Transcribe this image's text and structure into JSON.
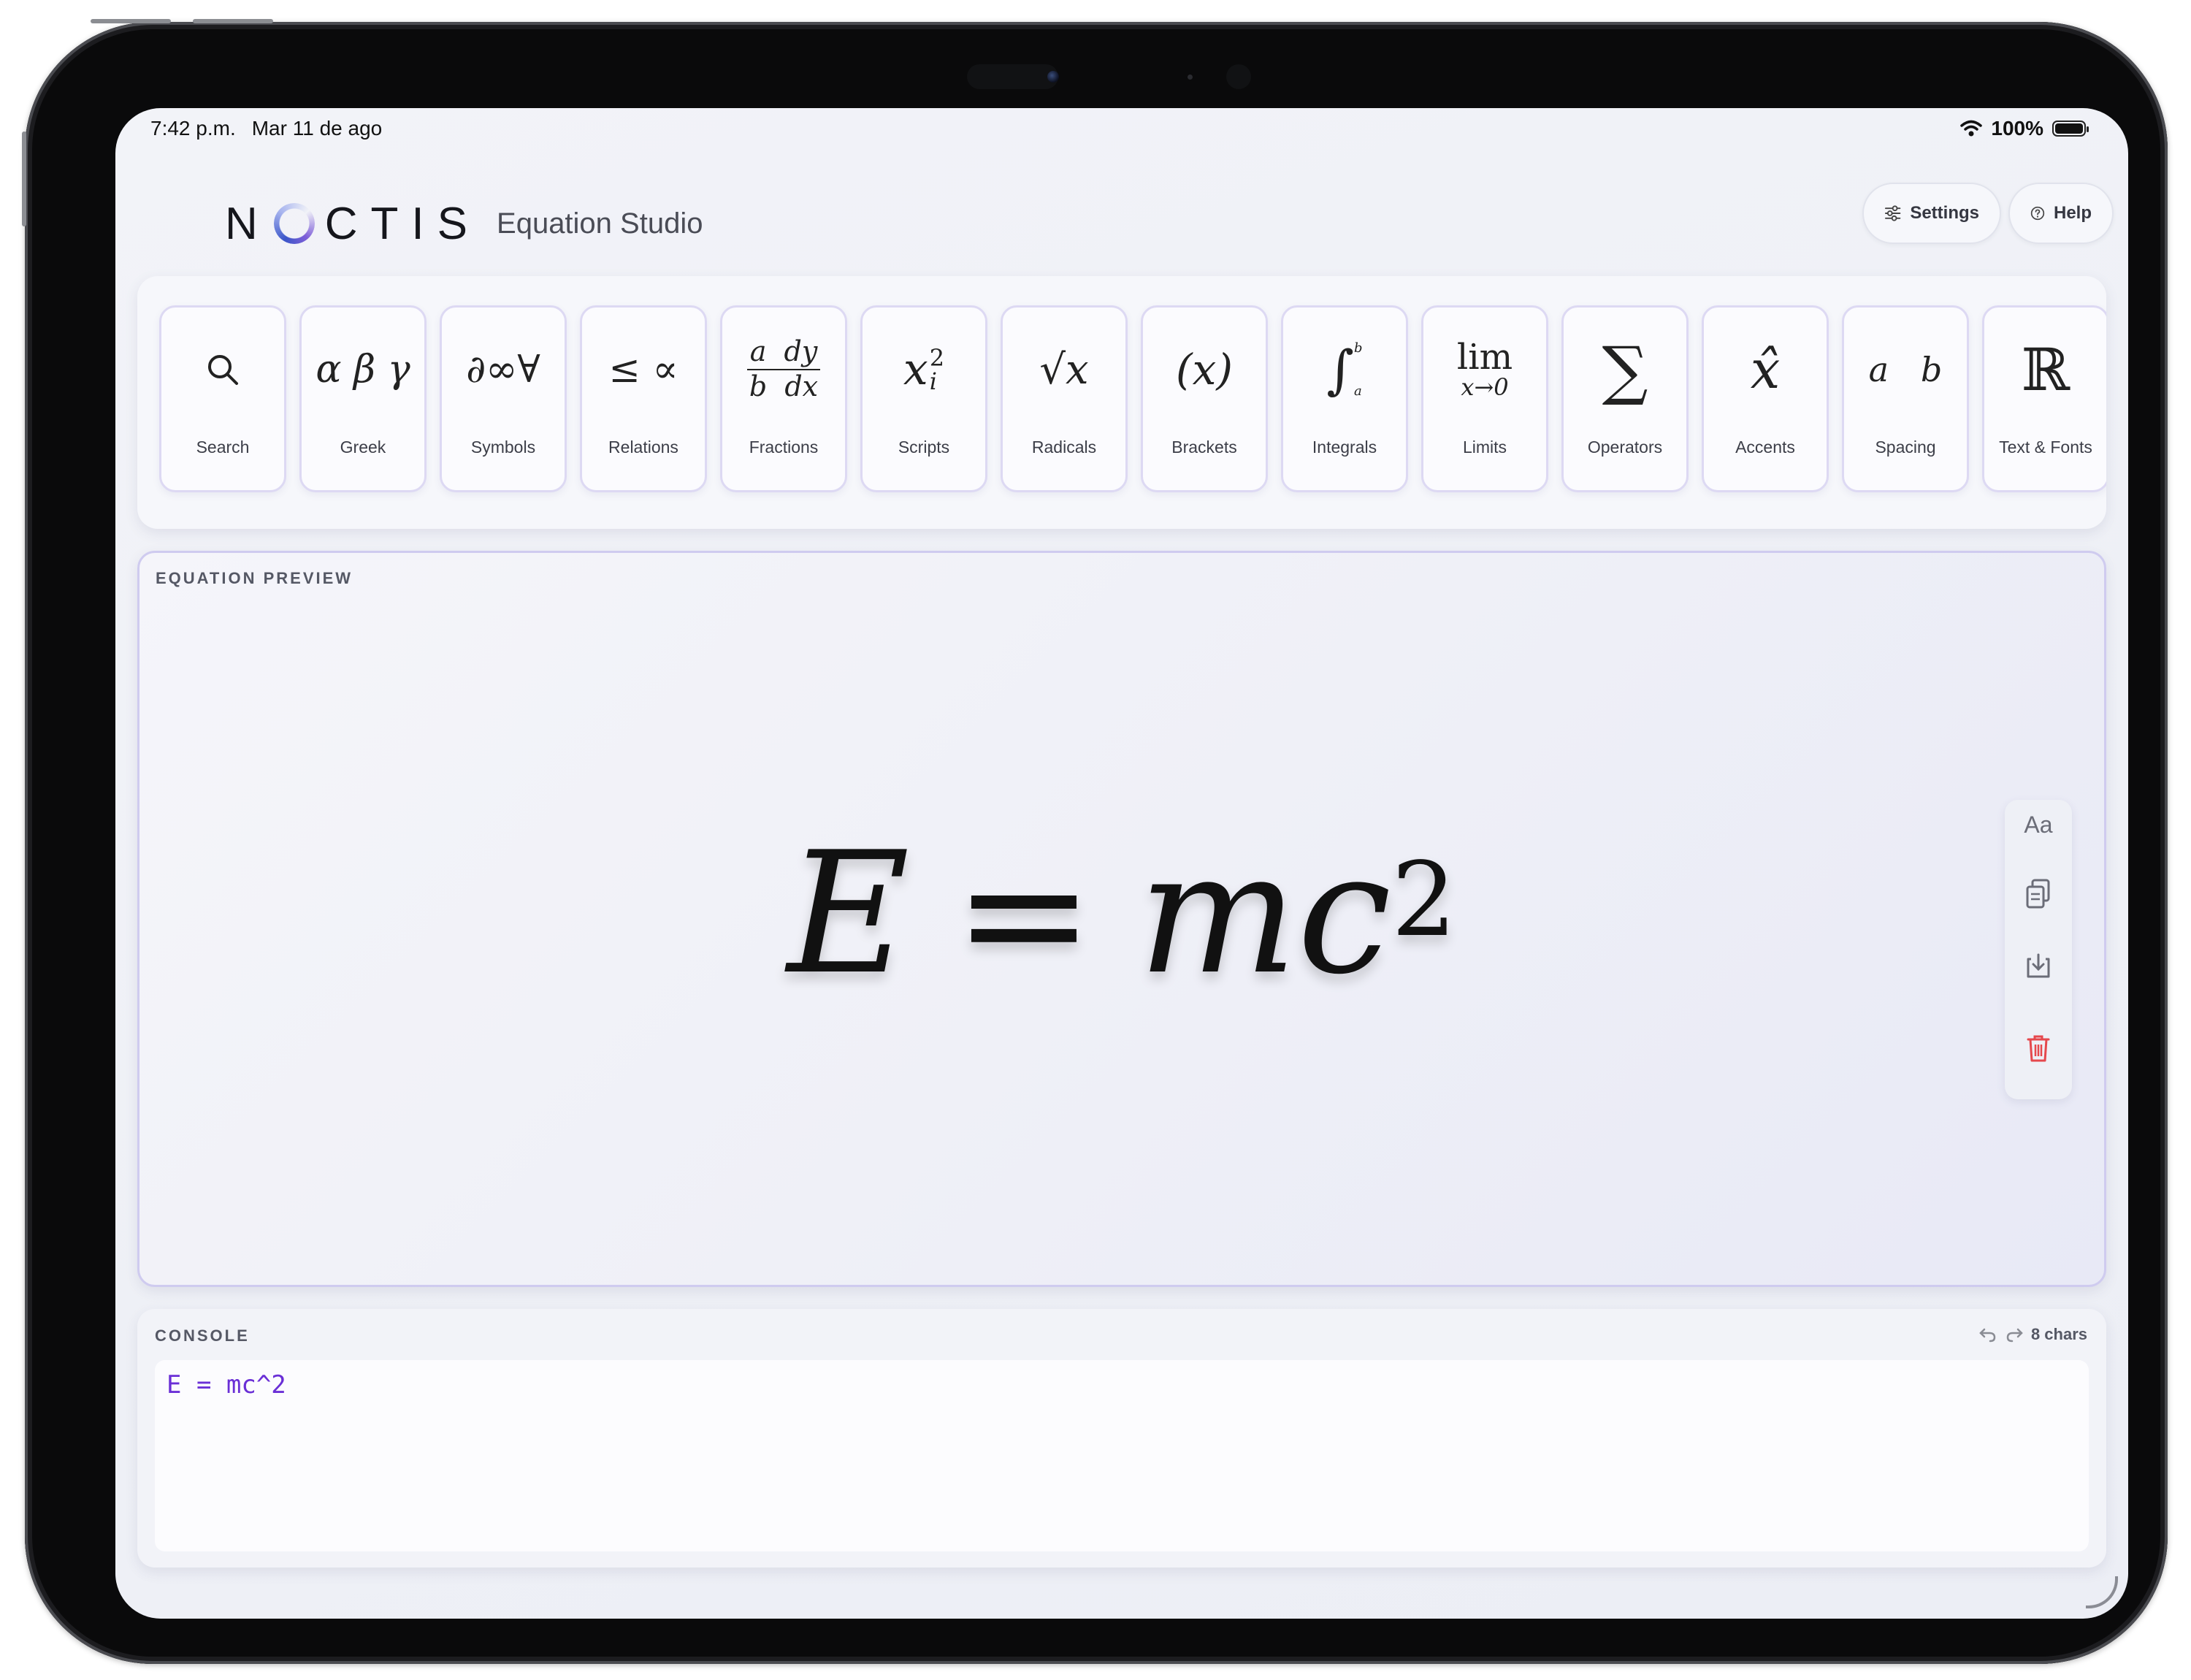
{
  "status_bar": {
    "time": "7:42 p.m.",
    "date": "Mar 11 de ago",
    "battery": "100%"
  },
  "header": {
    "logo_left": "N",
    "logo_right": "CTIS",
    "subtitle": "Equation Studio",
    "settings_label": "Settings",
    "help_label": "Help"
  },
  "toolbar": {
    "tiles": [
      {
        "label": "Search",
        "icon": "search-icon"
      },
      {
        "label": "Greek",
        "glyph": "α β γ"
      },
      {
        "label": "Symbols",
        "glyph": "∂∞∀"
      },
      {
        "label": "Relations",
        "glyph": "≤ ∝"
      },
      {
        "label": "Fractions",
        "glyph_top": "a  dy",
        "glyph_bottom": "b  dx"
      },
      {
        "label": "Scripts",
        "glyph": "x",
        "sup": "2",
        "sub": "i"
      },
      {
        "label": "Radicals",
        "glyph": "√x"
      },
      {
        "label": "Brackets",
        "glyph": "(x)"
      },
      {
        "label": "Integrals",
        "glyph": "∫",
        "upper": "b",
        "lower": "a"
      },
      {
        "label": "Limits",
        "glyph": "lim",
        "under": "x→0"
      },
      {
        "label": "Operators",
        "glyph": "∑"
      },
      {
        "label": "Accents",
        "glyph": "x̂"
      },
      {
        "label": "Spacing",
        "glyph": "a   b"
      },
      {
        "label": "Text & Fonts",
        "glyph": "ℝ"
      }
    ]
  },
  "preview": {
    "section_label": "EQUATION PREVIEW",
    "equation_lhs": "E",
    "equation_op": "=",
    "equation_rhs": "mc",
    "equation_exp": "2",
    "tools": {
      "font_label": "Aa"
    }
  },
  "console": {
    "section_label": "CONSOLE",
    "input_value": "E = mc^2",
    "char_count": "8 chars"
  },
  "colors": {
    "accent": "#6a2fd6",
    "tile_border": "#ddd9f3",
    "delete": "#e5484d"
  }
}
